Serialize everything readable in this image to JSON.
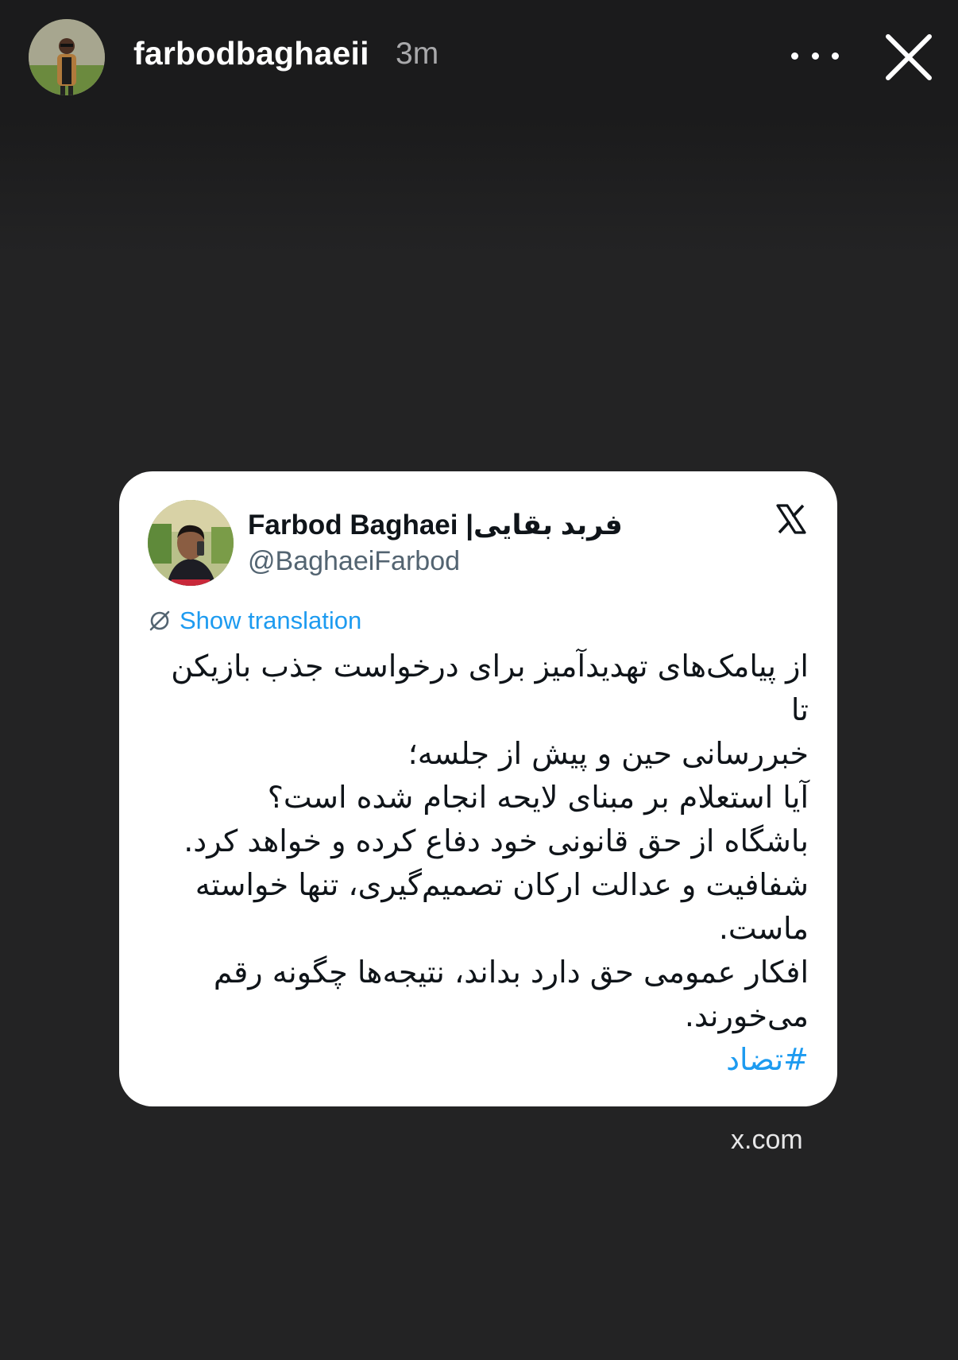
{
  "story": {
    "username": "farbodbaghaeii",
    "time_ago": "3m",
    "icons": {
      "more": "more-horizontal-icon",
      "close": "close-icon"
    }
  },
  "tweet": {
    "author_name": "Farbod Baghaei |فربد بقایی",
    "author_handle": "@BaghaeiFarbod",
    "platform_icon": "x-logo-icon",
    "translate_label": "Show translation",
    "lines": [
      "از پیامک‌های تهدیدآمیز برای درخواست جذب بازیکن تا",
      "خبررسانی حین و پیش از جلسه؛",
      "آیا استعلام بر مبنای لایحه انجام شده است؟",
      "باشگاه از حق قانونی خود دفاع کرده و خواهد کرد.",
      "شفافیت و عدالت ارکان تصمیم‌گیری، تنها خواسته",
      "ماست.",
      "افکار عمومی حق دارد بداند، نتیجه‌ها چگونه رقم",
      "می‌خورند."
    ],
    "hashtag": "#تضاد",
    "colors": {
      "link": "#1d9bf0",
      "text": "#0f1419",
      "secondary": "#536471"
    }
  },
  "link_domain": "x.com",
  "colors": {
    "background": "#232324",
    "card": "#ffffff"
  }
}
